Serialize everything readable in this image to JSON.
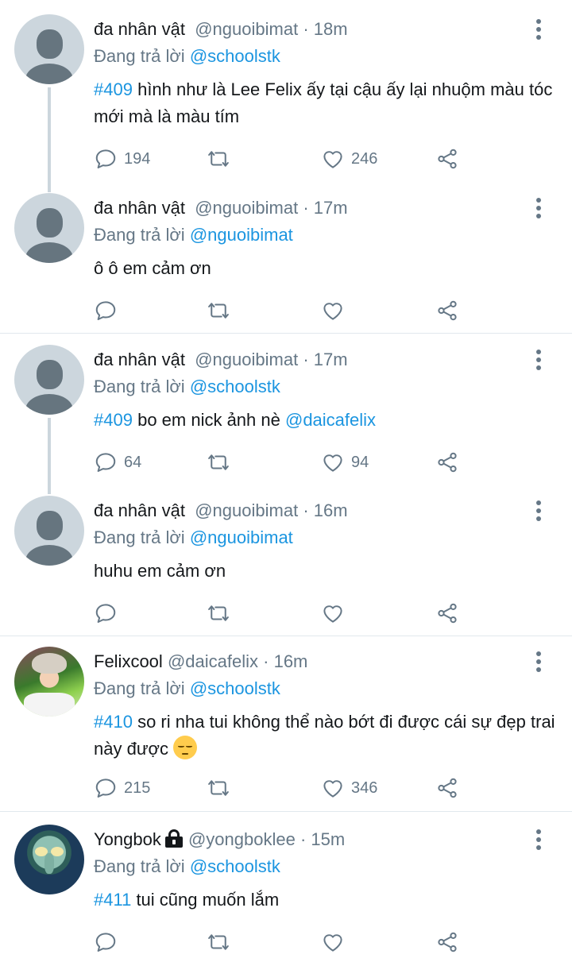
{
  "replying_to_prefix": "Đang trả lời",
  "colors": {
    "accent": "#1b95e0",
    "muted": "#657786",
    "text": "#14171a",
    "divider": "#e1e8ed"
  },
  "tweets": [
    {
      "name": "đa nhân vật",
      "handle": "@nguoibimat",
      "dot": "·",
      "time": "18m",
      "reply_to": "@schoolstk",
      "tag": "#409",
      "text": "hình như là Lee Felix ấy tại cậu ấy lại nhuộm màu tóc mới mà là màu tím",
      "replies": "194",
      "retweets": "",
      "likes": "246",
      "avatar": "default-avatar"
    },
    {
      "name": "đa nhân vật",
      "handle": "@nguoibimat",
      "dot": "·",
      "time": "17m",
      "reply_to": "@nguoibimat",
      "tag": "",
      "text": "ô ô em cảm ơn",
      "replies": "",
      "retweets": "",
      "likes": "",
      "avatar": "default-avatar"
    },
    {
      "name": "đa nhân vật",
      "handle": "@nguoibimat",
      "dot": "·",
      "time": "17m",
      "reply_to": "@schoolstk",
      "tag": "#409",
      "text": "bo em nick ảnh nè",
      "mention": "@daicafelix",
      "replies": "64",
      "retweets": "",
      "likes": "94",
      "avatar": "default-avatar"
    },
    {
      "name": "đa nhân vật",
      "handle": "@nguoibimat",
      "dot": "·",
      "time": "16m",
      "reply_to": "@nguoibimat",
      "tag": "",
      "text": "huhu em cảm ơn",
      "replies": "",
      "retweets": "",
      "likes": "",
      "avatar": "default-avatar"
    },
    {
      "name": "Felixcool",
      "handle": "@daicafelix",
      "dot": "·",
      "time": "16m",
      "reply_to": "@schoolstk",
      "tag": "#410",
      "text": "so ri nha tui không thể nào bớt đi được cái sự đẹp trai này được",
      "replies": "215",
      "retweets": "",
      "likes": "346",
      "avatar": "profile-photo",
      "emoji": "relieved-face-emoji"
    },
    {
      "name": "Yongbok",
      "handle": "@yongboklee",
      "dot": "·",
      "time": "15m",
      "reply_to": "@schoolstk",
      "tag": "#411",
      "text": "tui cũng muốn lắm",
      "replies": "",
      "retweets": "",
      "likes": "",
      "avatar": "profile-photo",
      "protected": "lock-icon"
    }
  ]
}
